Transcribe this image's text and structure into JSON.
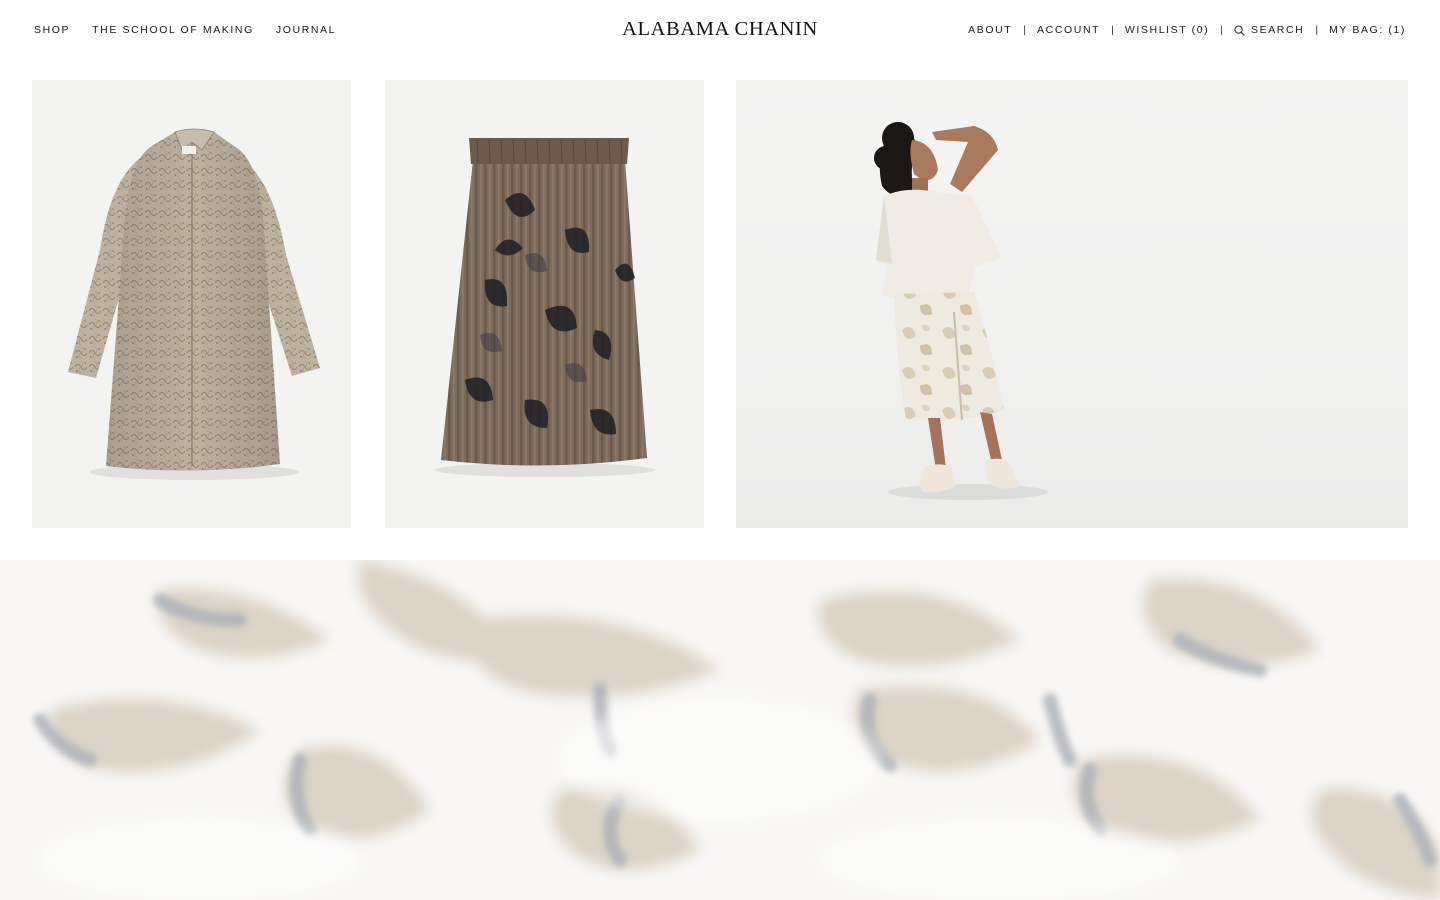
{
  "header": {
    "nav_left": [
      {
        "label": "SHOP"
      },
      {
        "label": "THE SCHOOL OF MAKING"
      },
      {
        "label": "JOURNAL"
      }
    ],
    "logo": "ALABAMA CHANIN",
    "nav_right": {
      "about": "ABOUT",
      "account": "ACCOUNT",
      "wishlist": "WISHLIST (0)",
      "search": "SEARCH",
      "bag": "MY BAG: (1)",
      "separator": "|"
    }
  },
  "products": [
    {
      "image": "embroidered-long-coat",
      "bg_color": "#f3f3f2"
    },
    {
      "image": "printed-gathered-skirt",
      "bg_color": "#f3f3f2"
    },
    {
      "image": "model-in-ivory-top-and-skirt",
      "bg_color": "#f3f3f2"
    }
  ],
  "banner": {
    "image": "appliqued-leaf-fabric-closeup",
    "bg_color": "#f7f6f3"
  },
  "icons": {
    "search": "search-icon"
  },
  "colors": {
    "text": "#1a1a1a",
    "background": "#ffffff",
    "coat": "#bcb09f",
    "skirt": "#7b6b5c",
    "ivory": "#efe9df"
  }
}
